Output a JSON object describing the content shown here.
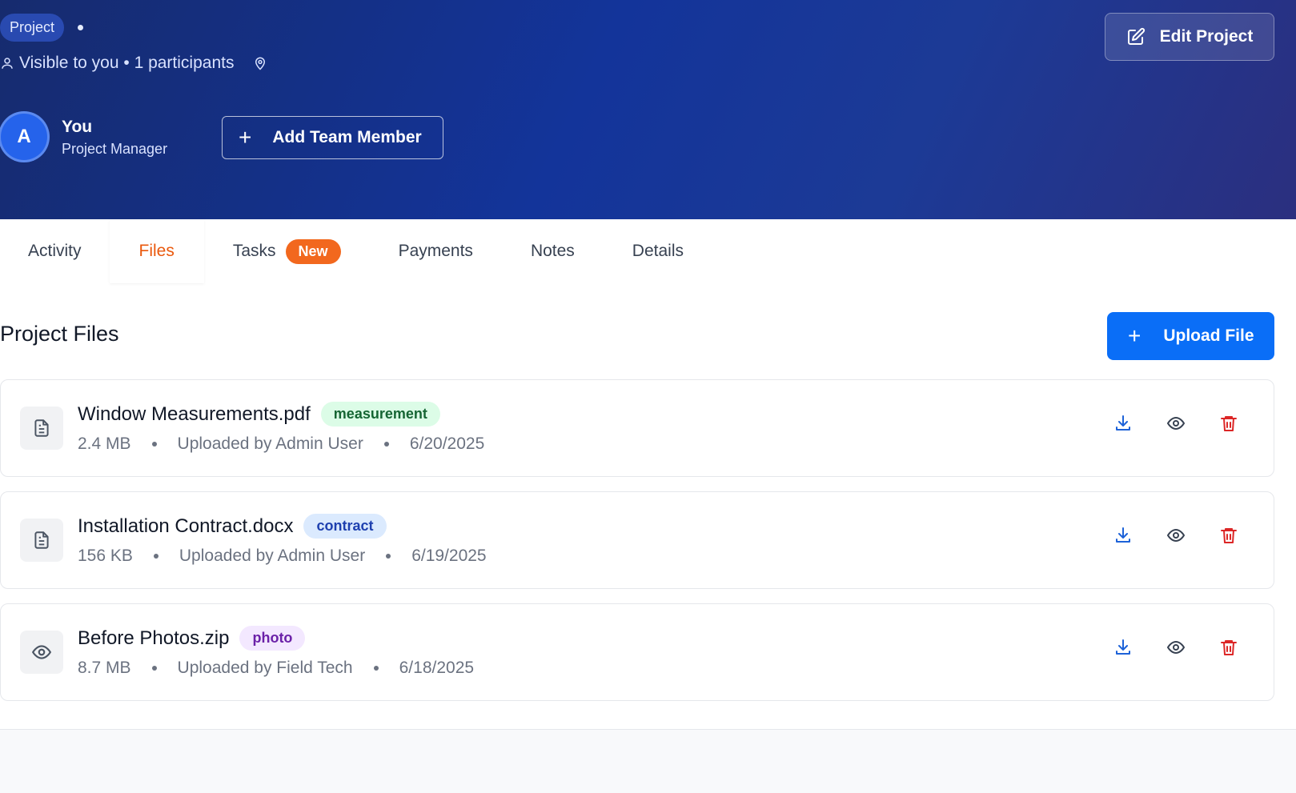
{
  "header": {
    "badge": "Project",
    "visibility": "Visible to you",
    "participants": "1 participants",
    "edit_label": "Edit Project",
    "member": {
      "initial": "A",
      "name": "You",
      "role": "Project Manager"
    },
    "add_member_label": "Add Team Member"
  },
  "tabs": [
    {
      "label": "Activity"
    },
    {
      "label": "Files",
      "active": true
    },
    {
      "label": "Tasks",
      "badge": "New"
    },
    {
      "label": "Payments"
    },
    {
      "label": "Notes"
    },
    {
      "label": "Details"
    }
  ],
  "files_section": {
    "title": "Project Files",
    "upload_label": "Upload File",
    "files": [
      {
        "name": "Window Measurements.pdf",
        "tag": "measurement",
        "size": "2.4 MB",
        "uploader": "Uploaded by Admin User",
        "date": "6/20/2025",
        "icon": "document-icon"
      },
      {
        "name": "Installation Contract.docx",
        "tag": "contract",
        "size": "156 KB",
        "uploader": "Uploaded by Admin User",
        "date": "6/19/2025",
        "icon": "document-icon"
      },
      {
        "name": "Before Photos.zip",
        "tag": "photo",
        "size": "8.7 MB",
        "uploader": "Uploaded by Field Tech",
        "date": "6/18/2025",
        "icon": "eye-icon"
      }
    ]
  },
  "colors": {
    "accent_orange": "#ea580c",
    "primary_blue": "#0a6ef7",
    "delete_red": "#dc2626",
    "header_navy": "#13349a"
  }
}
